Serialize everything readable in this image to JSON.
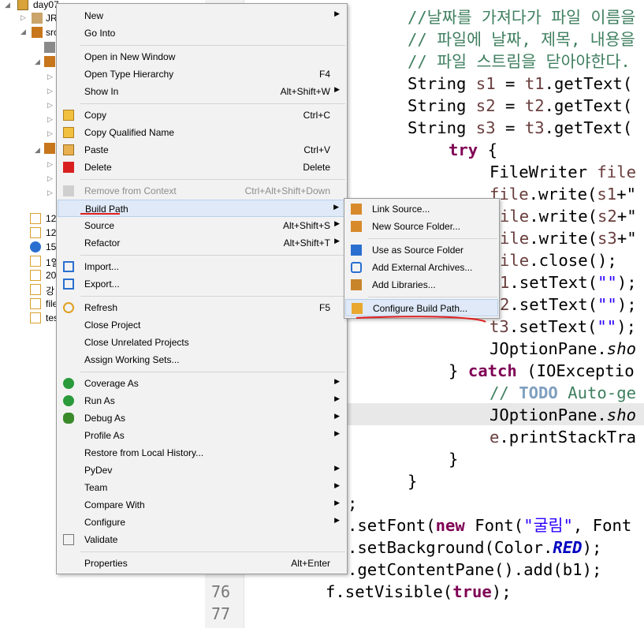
{
  "explorer": {
    "rows": [
      {
        "label": "day07"
      },
      {
        "label": "JR"
      },
      {
        "label": "src"
      },
      {
        "label": "12"
      },
      {
        "label": "12"
      },
      {
        "label": "15"
      },
      {
        "label": "1일"
      },
      {
        "label": "20"
      },
      {
        "label": "강"
      },
      {
        "label": "file"
      },
      {
        "label": "tes"
      }
    ]
  },
  "editor": {
    "line_numbers": [
      "76",
      "77"
    ],
    "lines": {
      "l1_comment": "//날짜를 가져다가 파일 이름을 만든",
      "l2_comment": "// 파일에 날짜, 제목, 내용을 기",
      "l3_comment": "// 파일 스트림을 닫아야한다.",
      "l4_kw": "String ",
      "l4_var": "s1",
      "l4_rest": " = ",
      "l4_var2": "t1",
      "l4_tail": ".getText(",
      "l5_kw": "String ",
      "l5_var": "s2",
      "l5_rest": " = ",
      "l5_var2": "t2",
      "l5_tail": ".getText(",
      "l6_kw": "String ",
      "l6_var": "s3",
      "l6_rest": " = ",
      "l6_var2": "t3",
      "l6_tail": ".getText(",
      "l7_kw": "try",
      "l7_rest": " {",
      "l8": "FileWriter ",
      "l8_var": "file",
      "l9_var": "file",
      "l9_rest": ".write(",
      "l9_var2": "s1",
      "l9_tail": "+\"",
      "l10_var": "ile",
      "l10_rest": ".write(",
      "l10_var2": "s2",
      "l10_tail": "+\"",
      "l11_var": "ile",
      "l11_rest": ".write(",
      "l11_var2": "s3",
      "l11_tail": "+\"",
      "l12_var": "ile",
      "l12_rest": ".close();",
      "l13_var": "1",
      "l13_rest": ".setText(",
      "l13_str": "\"\"",
      "l13_tail": ");",
      "l14_var": "2",
      "l14_rest": ".setText(",
      "l14_str": "\"\"",
      "l14_tail": ");",
      "l15_var": "t3",
      "l15_rest": ".setText(",
      "l15_str": "\"\"",
      "l15_tail": ");",
      "l16": "JOptionPane.",
      "l16_it": "sho",
      "l17_a": "} ",
      "l17_kw": "catch",
      "l17_rest": " (IOExceptio",
      "l18_cm": "// ",
      "l18_todo": "TODO",
      "l18_rest": " Auto-ge",
      "l19": "JOptionPane.",
      "l19_it": "sho",
      "l20_var": "e",
      "l20_rest": ".printStackTra",
      "l21": "}",
      "l22": "}",
      "l23": ";",
      "l24_a": ".setFont(",
      "l24_kw": "new",
      "l24_b": " Font(",
      "l24_str": "\"굴림\"",
      "l24_c": ", Font",
      "l25_a": ".setBackground(Color.",
      "l25_cst": "RED",
      "l25_b": ");",
      "l26": ".getContentPane().add(b1);",
      "l27_a": "f.setVisible(",
      "l27_kw": "true",
      "l27_b": ");"
    }
  },
  "context_menu": {
    "items": [
      {
        "label": "New",
        "accel": ""
      },
      {
        "label": "Go Into",
        "accel": ""
      },
      {
        "label": "Open in New Window",
        "accel": ""
      },
      {
        "label": "Open Type Hierarchy",
        "accel": "F4"
      },
      {
        "label": "Show In",
        "accel": "Alt+Shift+W"
      },
      {
        "label": "Copy",
        "accel": "Ctrl+C"
      },
      {
        "label": "Copy Qualified Name",
        "accel": ""
      },
      {
        "label": "Paste",
        "accel": "Ctrl+V"
      },
      {
        "label": "Delete",
        "accel": "Delete"
      },
      {
        "label": "Remove from Context",
        "accel": "Ctrl+Alt+Shift+Down"
      },
      {
        "label": "Build Path",
        "accel": ""
      },
      {
        "label": "Source",
        "accel": "Alt+Shift+S"
      },
      {
        "label": "Refactor",
        "accel": "Alt+Shift+T"
      },
      {
        "label": "Import...",
        "accel": ""
      },
      {
        "label": "Export...",
        "accel": ""
      },
      {
        "label": "Refresh",
        "accel": "F5"
      },
      {
        "label": "Close Project",
        "accel": ""
      },
      {
        "label": "Close Unrelated Projects",
        "accel": ""
      },
      {
        "label": "Assign Working Sets...",
        "accel": ""
      },
      {
        "label": "Coverage As",
        "accel": ""
      },
      {
        "label": "Run As",
        "accel": ""
      },
      {
        "label": "Debug As",
        "accel": ""
      },
      {
        "label": "Profile As",
        "accel": ""
      },
      {
        "label": "Restore from Local History...",
        "accel": ""
      },
      {
        "label": "PyDev",
        "accel": ""
      },
      {
        "label": "Team",
        "accel": ""
      },
      {
        "label": "Compare With",
        "accel": ""
      },
      {
        "label": "Configure",
        "accel": ""
      },
      {
        "label": "Validate",
        "accel": ""
      },
      {
        "label": "Properties",
        "accel": "Alt+Enter"
      }
    ]
  },
  "build_path_submenu": {
    "items": [
      {
        "label": "Link Source..."
      },
      {
        "label": "New Source Folder..."
      },
      {
        "label": "Use as Source Folder"
      },
      {
        "label": "Add External Archives..."
      },
      {
        "label": "Add Libraries..."
      },
      {
        "label": "Configure Build Path..."
      }
    ]
  },
  "colors": {
    "annotation_red": "#e02020",
    "menu_highlight": "#dfe9f7"
  }
}
